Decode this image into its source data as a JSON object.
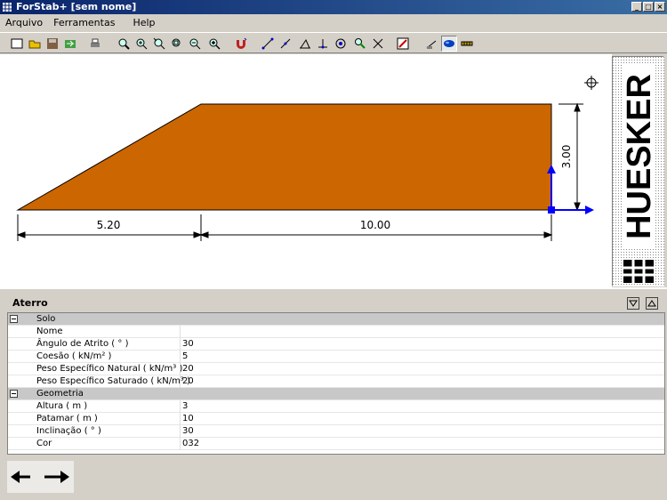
{
  "window": {
    "title": "ForStab+ [sem nome]"
  },
  "menu": [
    "Arquivo",
    "Ferramentas",
    "Help"
  ],
  "drawing": {
    "dim_base_left": "5.20",
    "dim_base_right": "10.00",
    "dim_height": "3.00",
    "fill_color": "#cc6600"
  },
  "logo": {
    "text": "HUESKER"
  },
  "panel": {
    "title": "Aterro",
    "sections": [
      {
        "name": "Solo",
        "rows": [
          {
            "label": "Nome",
            "value": ""
          },
          {
            "label": "Ângulo de Atrito ( ° )",
            "value": "30"
          },
          {
            "label": "Coesão ( kN/m² )",
            "value": "5"
          },
          {
            "label": "Peso Específico Natural ( kN/m³ )",
            "value": "20"
          },
          {
            "label": "Peso Específico Saturado ( kN/m³ )",
            "value": "20"
          }
        ]
      },
      {
        "name": "Geometria",
        "rows": [
          {
            "label": "Altura ( m )",
            "value": "3"
          },
          {
            "label": "Patamar ( m )",
            "value": "10"
          },
          {
            "label": "Inclinação ( ° )",
            "value": "30"
          },
          {
            "label": "Cor",
            "value": "032"
          }
        ]
      }
    ]
  }
}
